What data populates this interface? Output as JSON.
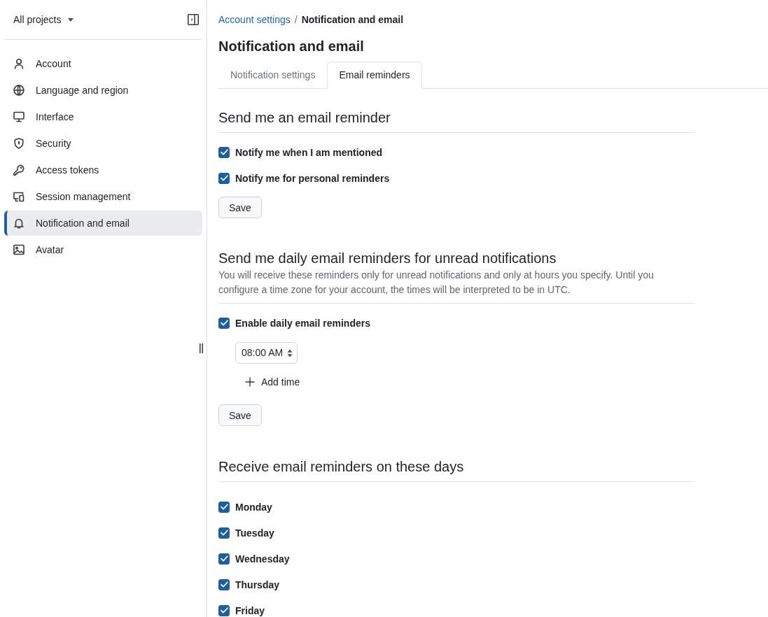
{
  "sidebar": {
    "project_selector": {
      "label": "All projects"
    },
    "items": [
      {
        "label": "Account",
        "selected": false
      },
      {
        "label": "Language and region",
        "selected": false
      },
      {
        "label": "Interface",
        "selected": false
      },
      {
        "label": "Security",
        "selected": false
      },
      {
        "label": "Access tokens",
        "selected": false
      },
      {
        "label": "Session management",
        "selected": false
      },
      {
        "label": "Notification and email",
        "selected": true
      },
      {
        "label": "Avatar",
        "selected": false
      }
    ]
  },
  "breadcrumb": {
    "items": [
      {
        "label": "Account settings",
        "kind": "link"
      },
      {
        "label": "Notification and email",
        "kind": "current"
      }
    ],
    "separator": "/"
  },
  "page_title": "Notification and email",
  "tabs": [
    {
      "label": "Notification settings",
      "selected": false
    },
    {
      "label": "Email reminders",
      "selected": true
    }
  ],
  "sections": [
    {
      "kind": "reminders",
      "heading": "Send me an email reminder",
      "options": [
        {
          "label": "Notify me when I am mentioned",
          "checked": true
        },
        {
          "label": "Notify me for personal reminders",
          "checked": true
        }
      ],
      "save_button": "Save"
    },
    {
      "kind": "schedule",
      "heading": "Send me daily email reminders for unread notifications",
      "description": "You will receive these reminders only for unread notifications and only at hours you specify. Until you configure a time zone for your account, the times will be interpreted to be in UTC.",
      "options": [
        {
          "label": "Enable daily email reminders",
          "checked": true
        }
      ],
      "times": [
        {
          "value": "08:00 AM"
        }
      ],
      "add_time_button": "Add time",
      "save_button": "Save"
    },
    {
      "kind": "days",
      "heading": "Receive email reminders on these days",
      "options": [
        {
          "label": "Monday",
          "checked": true
        },
        {
          "label": "Tuesday",
          "checked": true
        },
        {
          "label": "Wednesday",
          "checked": true
        },
        {
          "label": "Thursday",
          "checked": true
        },
        {
          "label": "Friday",
          "checked": true
        }
      ]
    }
  ]
}
